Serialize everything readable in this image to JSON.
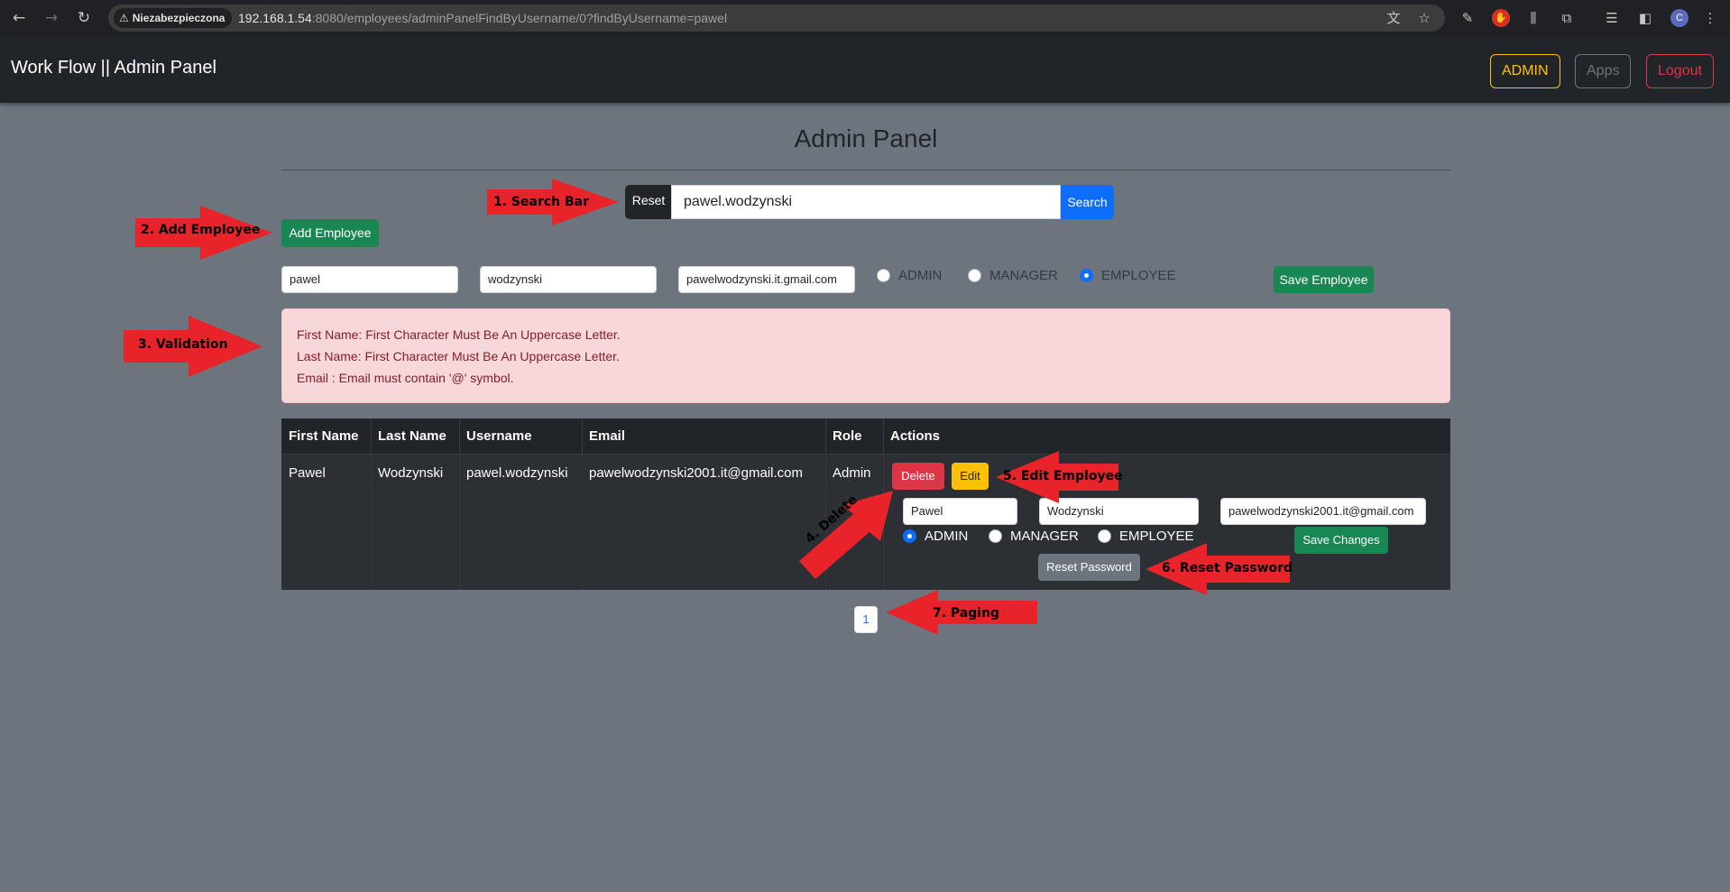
{
  "browser": {
    "back_icon": "arrow-left-icon",
    "forward_icon": "arrow-right-icon",
    "reload_icon": "reload-icon",
    "security_chip": "Niezabezpieczona",
    "url_host": "192.168.1.54",
    "url_rest": ":8080/employees/adminPanelFindByUsername/0?findByUsername=pawel",
    "profile_initial": "C"
  },
  "navbar": {
    "brand": "Work Flow || Admin Panel",
    "admin_label": "ADMIN",
    "apps_label": "Apps",
    "logout_label": "Logout"
  },
  "page": {
    "title": "Admin Panel"
  },
  "search": {
    "reset_label": "Reset",
    "value": "pawel.wodzynski",
    "button_label": "Search"
  },
  "add_employee": {
    "button_label": "Add Employee",
    "first_name": "pawel",
    "last_name": "wodzynski",
    "email": "pawelwodzynski.it.gmail.com",
    "roles": [
      "ADMIN",
      "MANAGER",
      "EMPLOYEE"
    ],
    "selected_role": "EMPLOYEE",
    "save_label": "Save Employee"
  },
  "validation": {
    "messages": [
      "First Name: First Character Must Be An Uppercase Letter.",
      "Last Name: First Character Must Be An Uppercase Letter.",
      "Email : Email must contain '@' symbol."
    ]
  },
  "table": {
    "headers": [
      "First Name",
      "Last Name",
      "Username",
      "Email",
      "Role",
      "Actions"
    ],
    "rows": [
      {
        "first_name": "Pawel",
        "last_name": "Wodzynski",
        "username": "pawel.wodzynski",
        "email": "pawelwodzynski2001.it@gmail.com",
        "role": "Admin",
        "delete_label": "Delete",
        "edit_label": "Edit",
        "edit_first_name": "Pawel",
        "edit_last_name": "Wodzynski",
        "edit_email": "pawelwodzynski2001.it@gmail.com",
        "edit_roles": [
          "ADMIN",
          "MANAGER",
          "EMPLOYEE"
        ],
        "edit_selected_role": "ADMIN",
        "save_changes_label": "Save Changes",
        "reset_password_label": "Reset Password"
      }
    ]
  },
  "pagination": {
    "pages": [
      "1"
    ]
  },
  "annotations": {
    "search_bar": "1. Search Bar",
    "add_employee": "2. Add Employee",
    "validation": "3. Validation",
    "delete": "4. Delete",
    "edit_employee": "5. Edit Employee",
    "reset_password": "6. Reset Password",
    "paging": "7. Paging",
    "arrow_color": "#e8232a"
  },
  "colors": {
    "page_background": "#6c757d",
    "navbar": "#212529",
    "primary": "#0d6efd",
    "success": "#198754",
    "danger": "#dc3545",
    "warning": "#ffc107",
    "alert_background": "#f8d7da"
  }
}
